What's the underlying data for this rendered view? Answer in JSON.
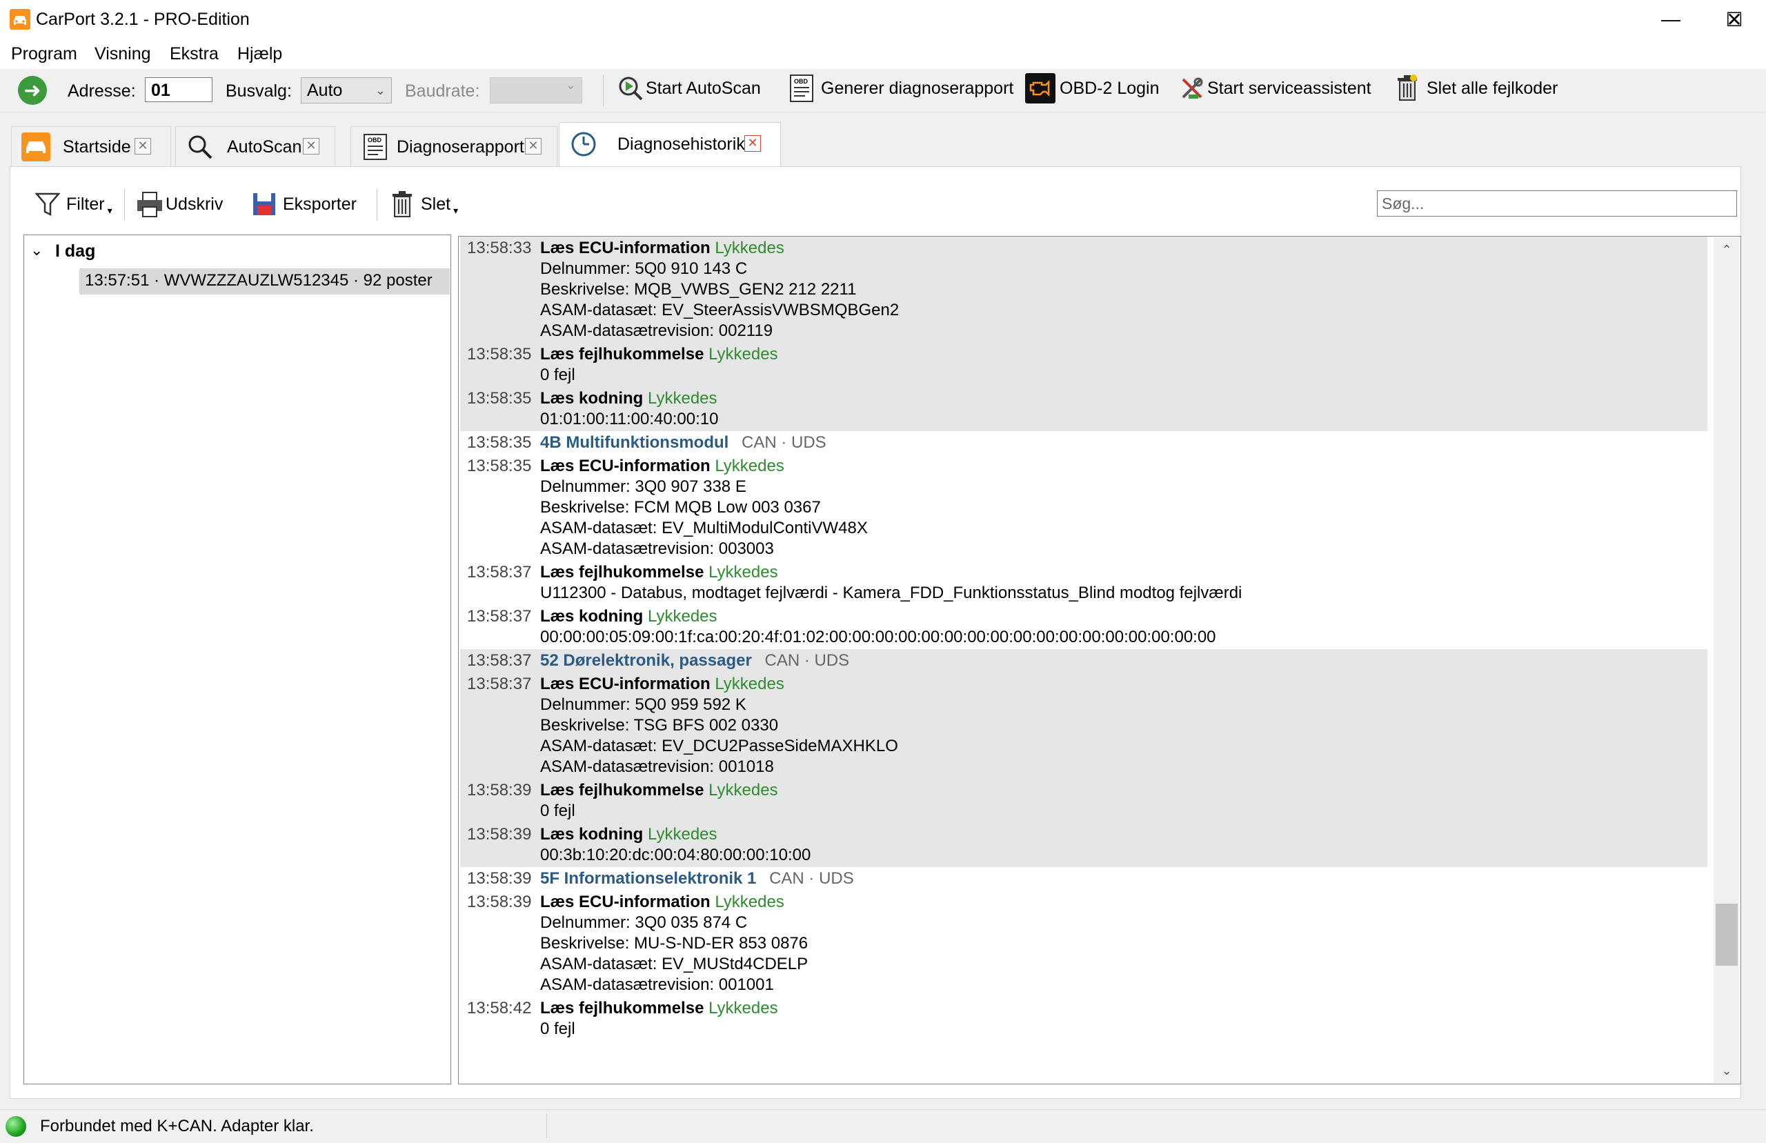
{
  "window": {
    "title": "CarPort 3.2.1 - PRO-Edition",
    "minimize": "—",
    "maximize": "☐",
    "close": "✕"
  },
  "menu": [
    "Program",
    "Visning",
    "Ekstra",
    "Hjælp"
  ],
  "toolbar": {
    "address_label": "Adresse:",
    "address_value": "01",
    "bus_label": "Busvalg:",
    "bus_value": "Auto",
    "baud_label": "Baudrate:",
    "autoscan": "Start AutoScan",
    "report": "Generer diagnoserapport",
    "obd_login": "OBD-2 Login",
    "service": "Start serviceassistent",
    "clear_codes": "Slet alle fejlkoder"
  },
  "tabs": [
    {
      "label": "Startside"
    },
    {
      "label": "AutoScan"
    },
    {
      "label": "Diagnoserapport"
    },
    {
      "label": "Diagnosehistorik"
    }
  ],
  "content_toolbar": {
    "filter": "Filter",
    "print": "Udskriv",
    "export": "Eksporter",
    "delete": "Slet",
    "search_placeholder": "Søg..."
  },
  "tree": {
    "group": "I dag",
    "entry": "13:57:51 · WVWZZZAUZLW512345 · 92 poster"
  },
  "log": [
    {
      "time": "13:58:33",
      "op": "Læs ECU-information",
      "status": "Lykkedes",
      "lines": [
        "Delnummer: 5Q0 910 143 C",
        "Beskrivelse: MQB_VWBS_GEN2 212 2211",
        "ASAM-datasæt: EV_SteerAssisVWBSMQBGen2",
        "ASAM-datasætrevision: 002119"
      ],
      "shaded": true
    },
    {
      "time": "13:58:35",
      "op": "Læs fejlhukommelse",
      "status": "Lykkedes",
      "lines": [
        "0 fejl"
      ],
      "shaded": true
    },
    {
      "time": "13:58:35",
      "op": "Læs kodning",
      "status": "Lykkedes",
      "lines": [
        "01:01:00:11:00:40:00:10"
      ],
      "shaded": true
    },
    {
      "time": "13:58:35",
      "module": "4B Multifunktionsmodul",
      "proto": "CAN · UDS",
      "shaded": false
    },
    {
      "time": "13:58:35",
      "op": "Læs ECU-information",
      "status": "Lykkedes",
      "lines": [
        "Delnummer: 3Q0 907 338 E",
        "Beskrivelse: FCM MQB Low 003 0367",
        "ASAM-datasæt: EV_MultiModulContiVW48X",
        "ASAM-datasætrevision: 003003"
      ],
      "shaded": false
    },
    {
      "time": "13:58:37",
      "op": "Læs fejlhukommelse",
      "status": "Lykkedes",
      "lines": [
        "U112300 - Databus, modtaget fejlværdi - Kamera_FDD_Funktionsstatus_Blind modtog fejlværdi"
      ],
      "shaded": false
    },
    {
      "time": "13:58:37",
      "op": "Læs kodning",
      "status": "Lykkedes",
      "lines": [
        "00:00:00:05:09:00:1f:ca:00:20:4f:01:02:00:00:00:00:00:00:00:00:00:00:00:00:00:00:00:00:00"
      ],
      "shaded": false
    },
    {
      "time": "13:58:37",
      "module": "52 Dørelektronik, passager",
      "proto": "CAN · UDS",
      "shaded": true
    },
    {
      "time": "13:58:37",
      "op": "Læs ECU-information",
      "status": "Lykkedes",
      "lines": [
        "Delnummer: 5Q0 959 592 K",
        "Beskrivelse: TSG BFS 002 0330",
        "ASAM-datasæt: EV_DCU2PasseSideMAXHKLO",
        "ASAM-datasætrevision: 001018"
      ],
      "shaded": true
    },
    {
      "time": "13:58:39",
      "op": "Læs fejlhukommelse",
      "status": "Lykkedes",
      "lines": [
        "0 fejl"
      ],
      "shaded": true
    },
    {
      "time": "13:58:39",
      "op": "Læs kodning",
      "status": "Lykkedes",
      "lines": [
        "00:3b:10:20:dc:00:04:80:00:00:10:00"
      ],
      "shaded": true
    },
    {
      "time": "13:58:39",
      "module": "5F Informationselektronik 1",
      "proto": "CAN · UDS",
      "shaded": false
    },
    {
      "time": "13:58:39",
      "op": "Læs ECU-information",
      "status": "Lykkedes",
      "lines": [
        "Delnummer: 3Q0 035 874 C",
        "Beskrivelse: MU-S-ND-ER 853 0876",
        "ASAM-datasæt: EV_MUStd4CDELP",
        "ASAM-datasætrevision: 001001"
      ],
      "shaded": false
    },
    {
      "time": "13:58:42",
      "op": "Læs fejlhukommelse",
      "status": "Lykkedes",
      "lines": [
        "0 fejl"
      ],
      "shaded": false
    }
  ],
  "status": {
    "text": "Forbundet med K+CAN. Adapter klar."
  },
  "icons": {
    "go": "go-arrow-icon",
    "autoscan": "scan-play-icon",
    "report": "obd-report-icon",
    "obd_login": "engine-warning-icon",
    "service": "service-tools-icon",
    "clear": "trash-icon"
  },
  "colors": {
    "accent": "#f7931e",
    "success": "#2f8b2f",
    "module": "#2b5b84",
    "shaded_row": "#e6e6e6"
  }
}
